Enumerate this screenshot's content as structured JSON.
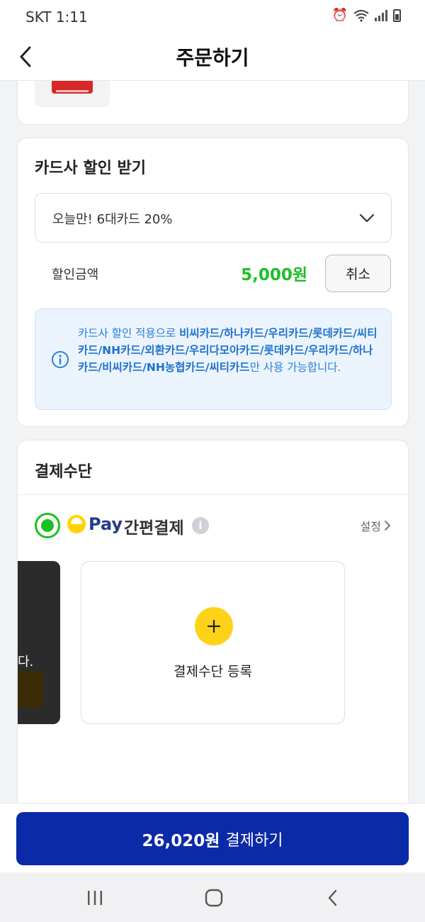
{
  "status_bar": {
    "time": "SKT 1:11",
    "icons": [
      "alarm-icon",
      "wifi-icon",
      "signal-icon",
      "battery-icon"
    ]
  },
  "header": {
    "title": "주문하기",
    "back_icon": "chevron-left-icon"
  },
  "card_discount": {
    "title": "카드사 할인 받기",
    "selected_option": "오늘만! 6대카드 20%",
    "discount_label": "할인금액",
    "discount_amount": "5,000원",
    "cancel_label": "취소",
    "info_prefix": "카드사 할인 적용으로 ",
    "info_cards": "비씨카드/하나카드/우리카드/롯데카드/씨티카드/NH카드/외환카드/우리다모아카드/롯데카드/우리카드/하나카드/비씨카드/NH농협카드/씨티카드",
    "info_suffix": "만 사용 가능합니다."
  },
  "payment": {
    "title": "결제수단",
    "pay_brand": "Pay",
    "pay_method_label": "간편결제",
    "settings_label": "설정",
    "partial_card_text": "다.",
    "register_label": "결제수단 등록"
  },
  "pay_button": {
    "amount": "26,020원",
    "label": "결제하기"
  },
  "colors": {
    "accent_green": "#1bc21f",
    "pay_blue": "#0a2aa8",
    "info_blue": "#2a7fd8",
    "plus_yellow": "#ffd21a"
  }
}
